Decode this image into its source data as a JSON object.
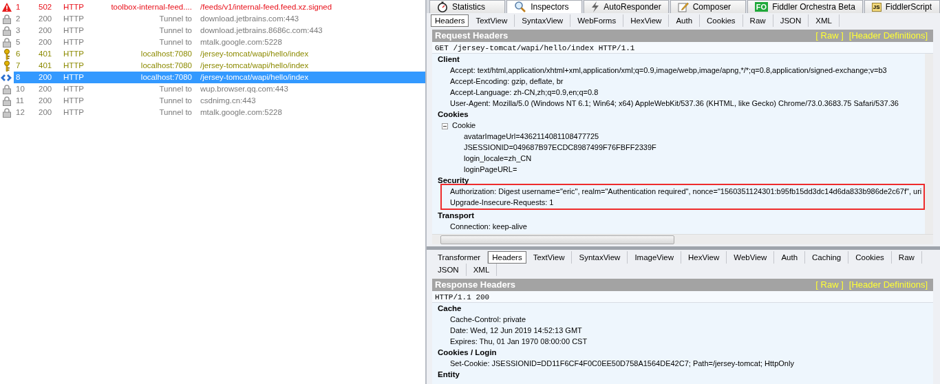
{
  "sessions": [
    {
      "kind": "error",
      "num": "1",
      "result": "502",
      "protocol": "HTTP",
      "host": "toolbox-internal-feed....",
      "url": "/feeds/v1/internal-feed.feed.xz.signed",
      "selected": false
    },
    {
      "kind": "tunnel",
      "num": "2",
      "result": "200",
      "protocol": "HTTP",
      "host": "Tunnel to",
      "url": "download.jetbrains.com:443",
      "selected": false
    },
    {
      "kind": "tunnel",
      "num": "3",
      "result": "200",
      "protocol": "HTTP",
      "host": "Tunnel to",
      "url": "download.jetbrains.8686c.com:443",
      "selected": false
    },
    {
      "kind": "tunnel",
      "num": "5",
      "result": "200",
      "protocol": "HTTP",
      "host": "Tunnel to",
      "url": "mtalk.google.com:5228",
      "selected": false
    },
    {
      "kind": "auth",
      "num": "6",
      "result": "401",
      "protocol": "HTTP",
      "host": "localhost:7080",
      "url": "/jersey-tomcat/wapi/hello/index",
      "selected": false
    },
    {
      "kind": "auth",
      "num": "7",
      "result": "401",
      "protocol": "HTTP",
      "host": "localhost:7080",
      "url": "/jersey-tomcat/wapi/hello/index",
      "selected": false
    },
    {
      "kind": "request",
      "num": "8",
      "result": "200",
      "protocol": "HTTP",
      "host": "localhost:7080",
      "url": "/jersey-tomcat/wapi/hello/index",
      "selected": true
    },
    {
      "kind": "tunnel",
      "num": "10",
      "result": "200",
      "protocol": "HTTP",
      "host": "Tunnel to",
      "url": "wup.browser.qq.com:443",
      "selected": false
    },
    {
      "kind": "tunnel",
      "num": "11",
      "result": "200",
      "protocol": "HTTP",
      "host": "Tunnel to",
      "url": "csdnimg.cn:443",
      "selected": false
    },
    {
      "kind": "tunnel",
      "num": "12",
      "result": "200",
      "protocol": "HTTP",
      "host": "Tunnel to",
      "url": "mtalk.google.com:5228",
      "selected": false
    }
  ],
  "main_tabs": [
    {
      "label": "Statistics",
      "selected": false
    },
    {
      "label": "Inspectors",
      "selected": true
    },
    {
      "label": "AutoResponder",
      "selected": false
    },
    {
      "label": "Composer",
      "selected": false
    },
    {
      "label": "Fiddler Orchestra Beta",
      "badge": "FO",
      "selected": false
    },
    {
      "label": "FiddlerScript",
      "badge": "JS",
      "selected": false
    }
  ],
  "request": {
    "tabs": [
      {
        "label": "Headers",
        "selected": true
      },
      {
        "label": "TextView",
        "selected": false
      },
      {
        "label": "SyntaxView",
        "selected": false
      },
      {
        "label": "WebForms",
        "selected": false
      },
      {
        "label": "HexView",
        "selected": false
      },
      {
        "label": "Auth",
        "selected": false
      },
      {
        "label": "Cookies",
        "selected": false
      },
      {
        "label": "Raw",
        "selected": false
      },
      {
        "label": "JSON",
        "selected": false
      },
      {
        "label": "XML",
        "selected": false
      }
    ],
    "title": "Request Headers",
    "links": [
      "[ Raw ]",
      "[Header Definitions]"
    ],
    "first_line": "GET /jersey-tomcat/wapi/hello/index HTTP/1.1",
    "groups": [
      {
        "name": "Client",
        "highlighted": false,
        "headers": [
          {
            "text": "Accept: text/html,application/xhtml+xml,application/xml;q=0.9,image/webp,image/apng,*/*;q=0.8,application/signed-exchange;v=b3"
          },
          {
            "text": "Accept-Encoding: gzip, deflate, br"
          },
          {
            "text": "Accept-Language: zh-CN,zh;q=0.9,en;q=0.8"
          },
          {
            "text": "User-Agent: Mozilla/5.0 (Windows NT 6.1; Win64; x64) AppleWebKit/537.36 (KHTML, like Gecko) Chrome/73.0.3683.75 Safari/537.36"
          }
        ]
      },
      {
        "name": "Cookies",
        "highlighted": false,
        "headers": [
          {
            "text": "Cookie",
            "expanded": true,
            "children": [
              {
                "text": "avatarImageUrl=4362114081108477725"
              },
              {
                "text": "JSESSIONID=049687B97ECDC8987499F76FBFF2339F"
              },
              {
                "text": "login_locale=zh_CN"
              },
              {
                "text": "loginPageURL="
              }
            ]
          }
        ]
      },
      {
        "name": "Security",
        "highlighted": true,
        "headers": [
          {
            "text": "Authorization: Digest username=\"eric\", realm=\"Authentication required\", nonce=\"1560351124301:b95fb15dd3dc14d6da833b986de2c67f\", uri"
          },
          {
            "text": "Upgrade-Insecure-Requests: 1"
          }
        ]
      },
      {
        "name": "Transport",
        "highlighted": false,
        "headers": [
          {
            "text": "Connection: keep-alive"
          }
        ]
      }
    ]
  },
  "response": {
    "tabs": [
      {
        "label": "Transformer",
        "selected": false
      },
      {
        "label": "Headers",
        "selected": true
      },
      {
        "label": "TextView",
        "selected": false
      },
      {
        "label": "SyntaxView",
        "selected": false
      },
      {
        "label": "ImageView",
        "selected": false
      },
      {
        "label": "HexView",
        "selected": false
      },
      {
        "label": "WebView",
        "selected": false
      },
      {
        "label": "Auth",
        "selected": false
      },
      {
        "label": "Caching",
        "selected": false
      },
      {
        "label": "Cookies",
        "selected": false
      },
      {
        "label": "Raw",
        "selected": false
      },
      {
        "label": "JSON",
        "selected": false
      },
      {
        "label": "XML",
        "selected": false
      }
    ],
    "title": "Response Headers",
    "links": [
      "[ Raw ]",
      "[Header Definitions]"
    ],
    "first_line": "HTTP/1.1 200",
    "groups": [
      {
        "name": "Cache",
        "headers": [
          {
            "text": "Cache-Control: private"
          },
          {
            "text": "Date: Wed, 12 Jun 2019 14:52:13 GMT"
          },
          {
            "text": "Expires: Thu, 01 Jan 1970 08:00:00 CST"
          }
        ]
      },
      {
        "name": "Cookies / Login",
        "headers": [
          {
            "text": "Set-Cookie: JSESSIONID=DD11F6CF4F0C0EE50D758A1564DE42C7; Path=/jersey-tomcat; HttpOnly"
          }
        ]
      },
      {
        "name": "Entity"
      }
    ]
  }
}
